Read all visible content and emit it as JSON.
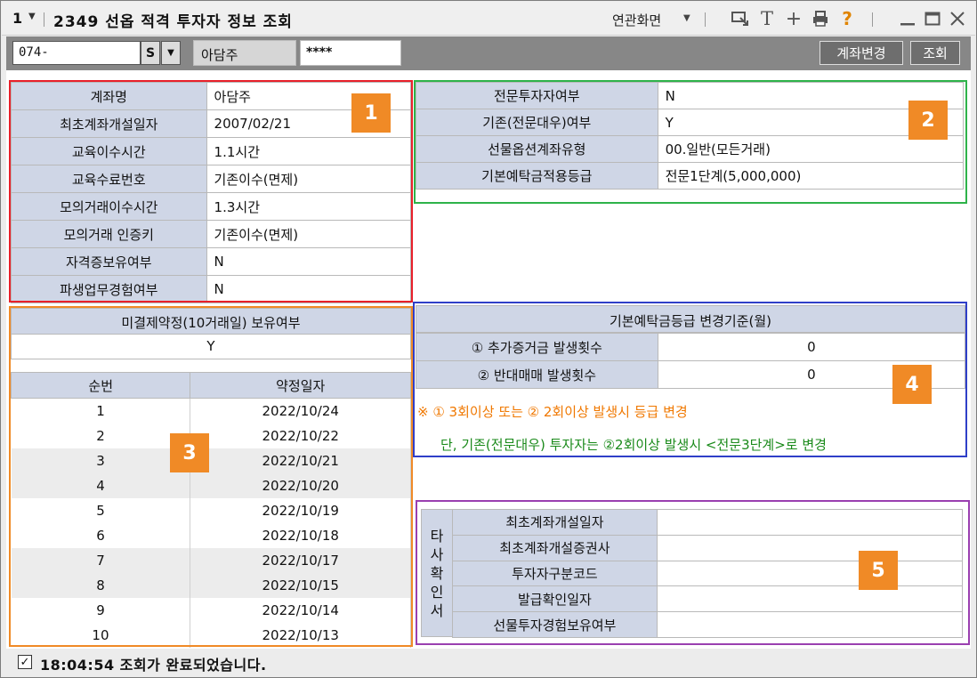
{
  "title_bar": {
    "window_number": "1",
    "screen_title": "2349 선옵 적격 투자자 정보 조회",
    "related_screens_label": "연관화면"
  },
  "input_bar": {
    "account_number": "074-",
    "s_button": "S",
    "account_name": "아담주",
    "password_mask": "****",
    "change_account_button": "계좌변경",
    "query_button": "조회"
  },
  "panel1": {
    "rows": [
      {
        "label": "계좌명",
        "value": "아담주"
      },
      {
        "label": "최초계좌개설일자",
        "value": "2007/02/21"
      },
      {
        "label": "교육이수시간",
        "value": "1.1시간"
      },
      {
        "label": "교육수료번호",
        "value": "기존이수(면제)"
      },
      {
        "label": "모의거래이수시간",
        "value": "1.3시간"
      },
      {
        "label": "모의거래 인증키",
        "value": "기존이수(면제)"
      },
      {
        "label": "자격증보유여부",
        "value": "N"
      },
      {
        "label": "파생업무경험여부",
        "value": "N"
      }
    ]
  },
  "panel2": {
    "rows": [
      {
        "label": "전문투자자여부",
        "value": "N"
      },
      {
        "label": "기존(전문대우)여부",
        "value": "Y"
      },
      {
        "label": "선물옵션계좌유형",
        "value": "00.일반(모든거래)"
      },
      {
        "label": "기본예탁금적용등급",
        "value": "전문1단계(5,000,000)"
      }
    ]
  },
  "panel3": {
    "header": "미결제약정(10거래일) 보유여부",
    "value": "Y",
    "columns": [
      "순번",
      "약정일자"
    ],
    "rows": [
      {
        "no": "1",
        "date": "2022/10/24"
      },
      {
        "no": "2",
        "date": "2022/10/22"
      },
      {
        "no": "3",
        "date": "2022/10/21"
      },
      {
        "no": "4",
        "date": "2022/10/20"
      },
      {
        "no": "5",
        "date": "2022/10/19"
      },
      {
        "no": "6",
        "date": "2022/10/18"
      },
      {
        "no": "7",
        "date": "2022/10/17"
      },
      {
        "no": "8",
        "date": "2022/10/15"
      },
      {
        "no": "9",
        "date": "2022/10/14"
      },
      {
        "no": "10",
        "date": "2022/10/13"
      }
    ]
  },
  "panel4": {
    "header": "기본예탁금등급 변경기준(월)",
    "rows": [
      {
        "label": "① 추가증거금 발생횟수",
        "value": "0"
      },
      {
        "label": "② 반대매매 발생횟수",
        "value": "0"
      }
    ],
    "note1": "※ ① 3회이상 또는 ② 2회이상 발생시 등급 변경",
    "note2": "단, 기존(전문대우) 투자자는 ②2회이상 발생시 <전문3단계>로 변경"
  },
  "panel5": {
    "side_label": [
      "타",
      "사",
      "확",
      "인",
      "서"
    ],
    "rows": [
      {
        "label": "최초계좌개설일자",
        "value": ""
      },
      {
        "label": "최초계좌개설증권사",
        "value": ""
      },
      {
        "label": "투자자구분코드",
        "value": ""
      },
      {
        "label": "발급확인일자",
        "value": ""
      },
      {
        "label": "선물투자경험보유여부",
        "value": ""
      }
    ]
  },
  "markers": [
    "1",
    "2",
    "3",
    "4",
    "5"
  ],
  "status_bar": {
    "time": "18:04:54",
    "message": "조회가 완료되었습니다."
  },
  "colors": {
    "label_bg": "#cfd6e6",
    "box1": "#e8202a",
    "box2": "#2eb34a",
    "box3": "#f08a26",
    "box4": "#2f3fc8",
    "box5": "#9a3fb0",
    "marker": "#f08a26",
    "note_orange": "#f07800",
    "note_green": "#1a8a1a"
  }
}
